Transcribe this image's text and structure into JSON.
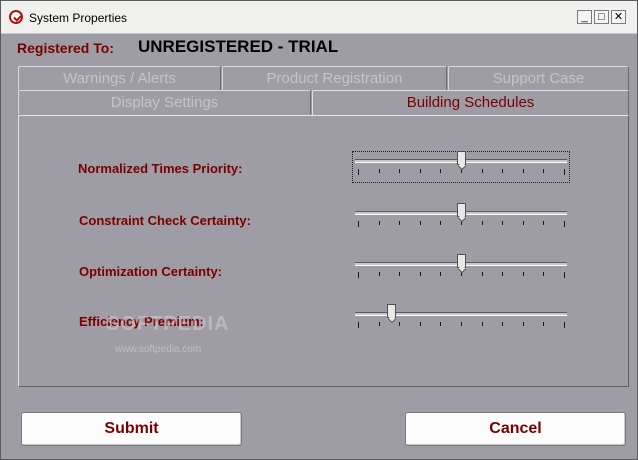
{
  "window": {
    "title": "System Properties",
    "minimize": "_",
    "maximize": "□",
    "close": "✕"
  },
  "registration": {
    "label": "Registered To:",
    "value": "UNREGISTERED - TRIAL"
  },
  "tabs": [
    {
      "label": "Warnings / Alerts",
      "active": false
    },
    {
      "label": "Product Registration",
      "active": false
    },
    {
      "label": "Support Case",
      "active": false
    },
    {
      "label": "Display Settings",
      "active": false
    },
    {
      "label": "Building Schedules",
      "active": true
    }
  ],
  "sliders": [
    {
      "label": "Normalized Times Priority:",
      "value": 0.5,
      "focused": true
    },
    {
      "label": "Constraint Check Certainty:",
      "value": 0.5,
      "focused": false
    },
    {
      "label": "Optimization Certainty:",
      "value": 0.5,
      "focused": false
    },
    {
      "label": "Efficiency Premium:",
      "value": 0.16,
      "focused": false
    }
  ],
  "slider_tick_count": 11,
  "buttons": {
    "submit": "Submit",
    "cancel": "Cancel"
  },
  "watermark": {
    "text": "SOFTPEDIA",
    "url": "www.softpedia.com"
  },
  "colors": {
    "label_red": "#7a0000",
    "background": "#9e9ca4"
  }
}
